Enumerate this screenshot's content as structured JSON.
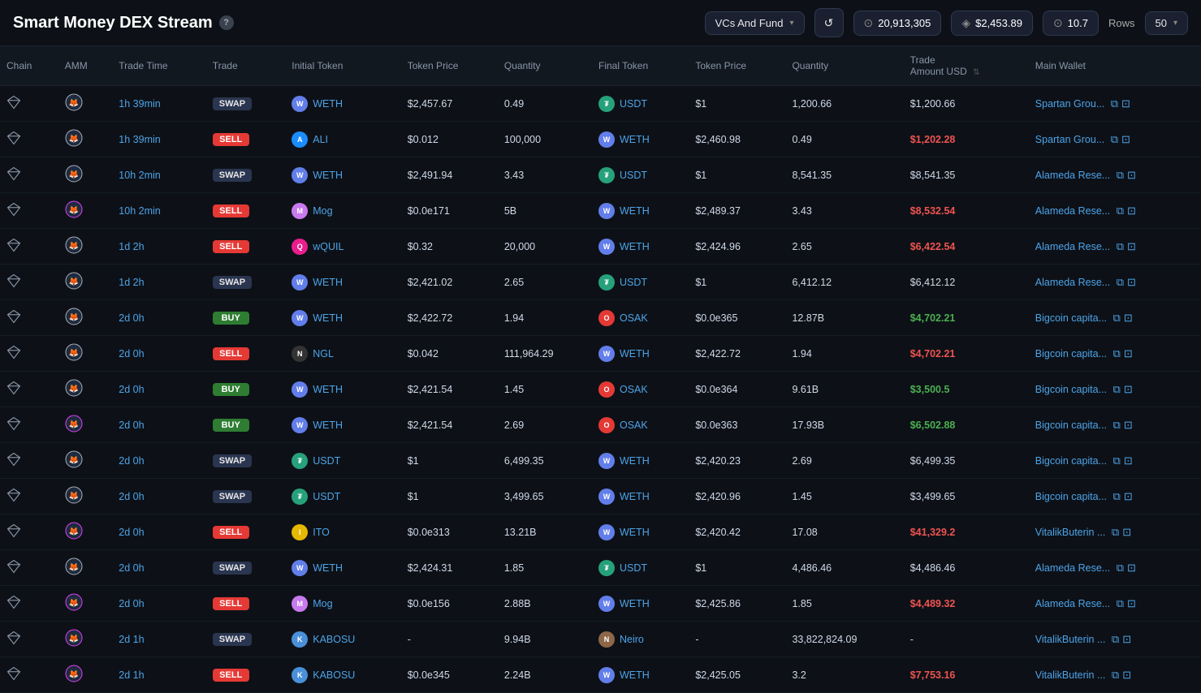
{
  "header": {
    "title": "Smart Money DEX Stream",
    "help_label": "?",
    "filter_label": "VCs And Fund",
    "refresh_icon": "↺",
    "stat1": {
      "icon": "⊙",
      "value": "20,913,305"
    },
    "stat2": {
      "icon": "◈",
      "value": "$2,453.89"
    },
    "stat3": {
      "icon": "⊙",
      "value": "10.7"
    },
    "rows_label": "Rows",
    "rows_value": "50"
  },
  "columns": [
    {
      "id": "chain",
      "label": "Chain"
    },
    {
      "id": "amm",
      "label": "AMM"
    },
    {
      "id": "trade_time",
      "label": "Trade Time"
    },
    {
      "id": "trade",
      "label": "Trade"
    },
    {
      "id": "initial_token",
      "label": "Initial Token"
    },
    {
      "id": "token_price_1",
      "label": "Token Price"
    },
    {
      "id": "quantity_1",
      "label": "Quantity"
    },
    {
      "id": "final_token",
      "label": "Final Token"
    },
    {
      "id": "token_price_2",
      "label": "Token Price"
    },
    {
      "id": "quantity_2",
      "label": "Quantity"
    },
    {
      "id": "trade_amount",
      "label": "Trade Amount USD",
      "sortable": true
    },
    {
      "id": "main_wallet",
      "label": "Main Wallet"
    }
  ],
  "rows": [
    {
      "chain": "diamond",
      "amm": "fox",
      "trade_time": "1h 39min",
      "trade_type": "SWAP",
      "initial_token": "WETH",
      "initial_token_class": "ti-weth",
      "token_price_1": "$2,457.67",
      "quantity_1": "0.49",
      "final_token": "USDT",
      "final_token_class": "ti-usdt",
      "token_price_2": "$1",
      "quantity_2": "1,200.66",
      "trade_amount": "$1,200.66",
      "trade_amount_type": "neutral",
      "wallet": "Spartan Grou..."
    },
    {
      "chain": "diamond",
      "amm": "fox",
      "trade_time": "1h 39min",
      "trade_type": "SELL",
      "initial_token": "ALI",
      "initial_token_class": "ti-ali",
      "token_price_1": "$0.012",
      "quantity_1": "100,000",
      "final_token": "WETH",
      "final_token_class": "ti-weth",
      "token_price_2": "$2,460.98",
      "quantity_2": "0.49",
      "trade_amount": "$1,202.28",
      "trade_amount_type": "red",
      "wallet": "Spartan Grou..."
    },
    {
      "chain": "diamond",
      "amm": "fox",
      "trade_time": "10h 2min",
      "trade_type": "SWAP",
      "initial_token": "WETH",
      "initial_token_class": "ti-weth",
      "token_price_1": "$2,491.94",
      "quantity_1": "3.43",
      "final_token": "USDT",
      "final_token_class": "ti-usdt",
      "token_price_2": "$1",
      "quantity_2": "8,541.35",
      "trade_amount": "$8,541.35",
      "trade_amount_type": "neutral",
      "wallet": "Alameda Rese..."
    },
    {
      "chain": "diamond",
      "amm": "fox-pink",
      "trade_time": "10h 2min",
      "trade_type": "SELL",
      "initial_token": "Mog",
      "initial_token_class": "ti-mog",
      "token_price_1": "$0.0e171",
      "quantity_1": "5B",
      "final_token": "WETH",
      "final_token_class": "ti-weth",
      "token_price_2": "$2,489.37",
      "quantity_2": "3.43",
      "trade_amount": "$8,532.54",
      "trade_amount_type": "red",
      "wallet": "Alameda Rese..."
    },
    {
      "chain": "diamond",
      "amm": "fox",
      "trade_time": "1d 2h",
      "trade_type": "SELL",
      "initial_token": "wQUIL",
      "initial_token_class": "ti-wquil",
      "token_price_1": "$0.32",
      "quantity_1": "20,000",
      "final_token": "WETH",
      "final_token_class": "ti-weth",
      "token_price_2": "$2,424.96",
      "quantity_2": "2.65",
      "trade_amount": "$6,422.54",
      "trade_amount_type": "red",
      "wallet": "Alameda Rese..."
    },
    {
      "chain": "diamond",
      "amm": "fox",
      "trade_time": "1d 2h",
      "trade_type": "SWAP",
      "initial_token": "WETH",
      "initial_token_class": "ti-weth",
      "token_price_1": "$2,421.02",
      "quantity_1": "2.65",
      "final_token": "USDT",
      "final_token_class": "ti-usdt",
      "token_price_2": "$1",
      "quantity_2": "6,412.12",
      "trade_amount": "$6,412.12",
      "trade_amount_type": "neutral",
      "wallet": "Alameda Rese..."
    },
    {
      "chain": "diamond",
      "amm": "fox",
      "trade_time": "2d 0h",
      "trade_type": "BUY",
      "initial_token": "WETH",
      "initial_token_class": "ti-weth",
      "token_price_1": "$2,422.72",
      "quantity_1": "1.94",
      "final_token": "OSAK",
      "final_token_class": "ti-osak",
      "token_price_2": "$0.0e365",
      "quantity_2": "12.87B",
      "trade_amount": "$4,702.21",
      "trade_amount_type": "green",
      "wallet": "Bigcoin capita..."
    },
    {
      "chain": "diamond",
      "amm": "fox",
      "trade_time": "2d 0h",
      "trade_type": "SELL",
      "initial_token": "NGL",
      "initial_token_class": "ti-ngl",
      "token_price_1": "$0.042",
      "quantity_1": "111,964.29",
      "final_token": "WETH",
      "final_token_class": "ti-weth",
      "token_price_2": "$2,422.72",
      "quantity_2": "1.94",
      "trade_amount": "$4,702.21",
      "trade_amount_type": "red",
      "wallet": "Bigcoin capita..."
    },
    {
      "chain": "diamond",
      "amm": "fox",
      "trade_time": "2d 0h",
      "trade_type": "BUY",
      "initial_token": "WETH",
      "initial_token_class": "ti-weth",
      "token_price_1": "$2,421.54",
      "quantity_1": "1.45",
      "final_token": "OSAK",
      "final_token_class": "ti-osak",
      "token_price_2": "$0.0e364",
      "quantity_2": "9.61B",
      "trade_amount": "$3,500.5",
      "trade_amount_type": "green",
      "wallet": "Bigcoin capita..."
    },
    {
      "chain": "diamond",
      "amm": "fox-pink",
      "trade_time": "2d 0h",
      "trade_type": "BUY",
      "initial_token": "WETH",
      "initial_token_class": "ti-weth",
      "token_price_1": "$2,421.54",
      "quantity_1": "2.69",
      "final_token": "OSAK",
      "final_token_class": "ti-osak",
      "token_price_2": "$0.0e363",
      "quantity_2": "17.93B",
      "trade_amount": "$6,502.88",
      "trade_amount_type": "green",
      "wallet": "Bigcoin capita..."
    },
    {
      "chain": "diamond",
      "amm": "fox",
      "trade_time": "2d 0h",
      "trade_type": "SWAP",
      "initial_token": "USDT",
      "initial_token_class": "ti-usdt",
      "token_price_1": "$1",
      "quantity_1": "6,499.35",
      "final_token": "WETH",
      "final_token_class": "ti-weth",
      "token_price_2": "$2,420.23",
      "quantity_2": "2.69",
      "trade_amount": "$6,499.35",
      "trade_amount_type": "neutral",
      "wallet": "Bigcoin capita..."
    },
    {
      "chain": "diamond",
      "amm": "fox",
      "trade_time": "2d 0h",
      "trade_type": "SWAP",
      "initial_token": "USDT",
      "initial_token_class": "ti-usdt",
      "token_price_1": "$1",
      "quantity_1": "3,499.65",
      "final_token": "WETH",
      "final_token_class": "ti-weth",
      "token_price_2": "$2,420.96",
      "quantity_2": "1.45",
      "trade_amount": "$3,499.65",
      "trade_amount_type": "neutral",
      "wallet": "Bigcoin capita..."
    },
    {
      "chain": "diamond",
      "amm": "fox-pink",
      "trade_time": "2d 0h",
      "trade_type": "SELL",
      "initial_token": "ITO",
      "initial_token_class": "ti-ito",
      "token_price_1": "$0.0e313",
      "quantity_1": "13.21B",
      "final_token": "WETH",
      "final_token_class": "ti-weth",
      "token_price_2": "$2,420.42",
      "quantity_2": "17.08",
      "trade_amount": "$41,329.2",
      "trade_amount_type": "red",
      "wallet": "VitalikButerin ..."
    },
    {
      "chain": "diamond",
      "amm": "fox",
      "trade_time": "2d 0h",
      "trade_type": "SWAP",
      "initial_token": "WETH",
      "initial_token_class": "ti-weth",
      "token_price_1": "$2,424.31",
      "quantity_1": "1.85",
      "final_token": "USDT",
      "final_token_class": "ti-usdt",
      "token_price_2": "$1",
      "quantity_2": "4,486.46",
      "trade_amount": "$4,486.46",
      "trade_amount_type": "neutral",
      "wallet": "Alameda Rese..."
    },
    {
      "chain": "diamond",
      "amm": "fox-pink",
      "trade_time": "2d 0h",
      "trade_type": "SELL",
      "initial_token": "Mog",
      "initial_token_class": "ti-mog",
      "token_price_1": "$0.0e156",
      "quantity_1": "2.88B",
      "final_token": "WETH",
      "final_token_class": "ti-weth",
      "token_price_2": "$2,425.86",
      "quantity_2": "1.85",
      "trade_amount": "$4,489.32",
      "trade_amount_type": "red",
      "wallet": "Alameda Rese..."
    },
    {
      "chain": "diamond",
      "amm": "fox-pink",
      "trade_time": "2d 1h",
      "trade_type": "SWAP",
      "initial_token": "KABOSU",
      "initial_token_class": "ti-kabosu",
      "token_price_1": "-",
      "quantity_1": "9.94B",
      "final_token": "Neiro",
      "final_token_class": "ti-neiro",
      "token_price_2": "-",
      "quantity_2": "33,822,824.09",
      "trade_amount": "-",
      "trade_amount_type": "neutral",
      "wallet": "VitalikButerin ..."
    },
    {
      "chain": "diamond",
      "amm": "fox-pink",
      "trade_time": "2d 1h",
      "trade_type": "SELL",
      "initial_token": "KABOSU",
      "initial_token_class": "ti-kabosu",
      "token_price_1": "$0.0e345",
      "quantity_1": "2.24B",
      "final_token": "WETH",
      "final_token_class": "ti-weth",
      "token_price_2": "$2,425.05",
      "quantity_2": "3.2",
      "trade_amount": "$7,753.16",
      "trade_amount_type": "red",
      "wallet": "VitalikButerin ..."
    }
  ]
}
